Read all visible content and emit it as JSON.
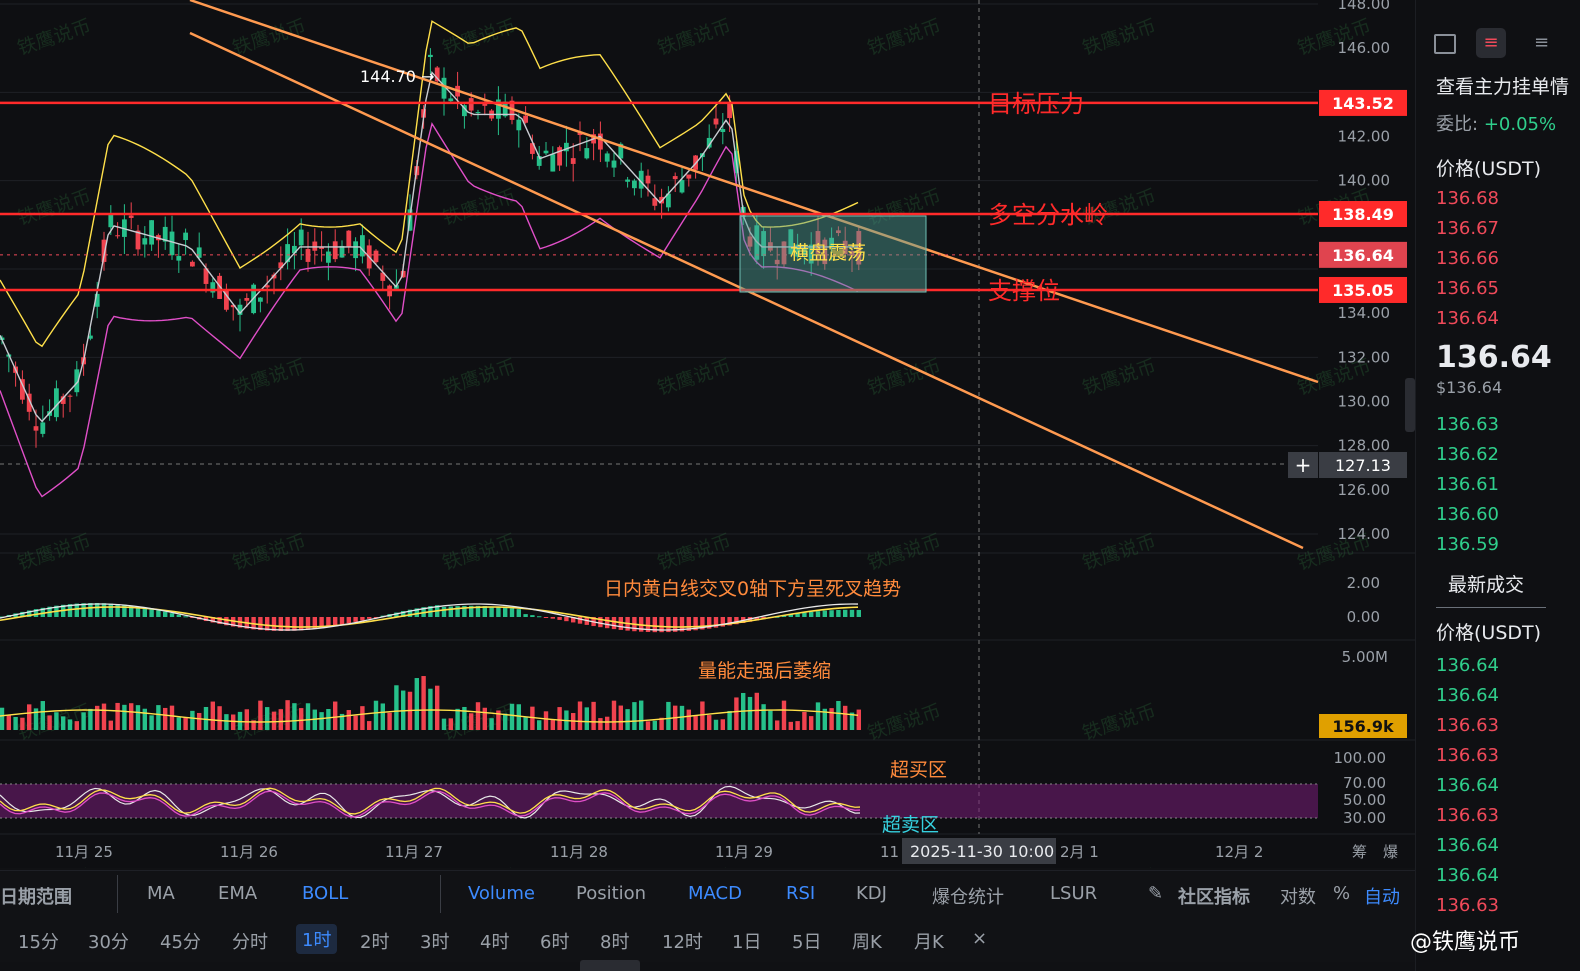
{
  "chart_data": {
    "type": "candlestick",
    "pair_unit": "USDT",
    "timeframe": "1时",
    "ylim": [
      122.5,
      148.5
    ],
    "y_ticks": [
      "148.00",
      "146.00",
      "142.00",
      "140.00",
      "134.00",
      "132.00",
      "130.00",
      "128.00",
      "126.00",
      "124.00"
    ],
    "x_ticks": [
      "11月 25",
      "11月 26",
      "11月 27",
      "11月 28",
      "11月 29",
      "11",
      "2025-11-30 10:00",
      "2月 1",
      "12月 2",
      "筹",
      "爆"
    ],
    "horizontal_levels": [
      {
        "value": 143.52,
        "label": "目标压力",
        "tag": "143.52"
      },
      {
        "value": 138.49,
        "label": "多空分水岭",
        "tag": "138.49"
      },
      {
        "value": 135.05,
        "label": "支撑位",
        "tag": "135.05"
      }
    ],
    "current_price": {
      "value": 136.64,
      "tag": "136.64"
    },
    "crosshair_price": "127.13",
    "high_marker": "144.70 →",
    "box_label": "横盘震荡",
    "indicators": {
      "macd": {
        "ticks": [
          "2.00",
          "0.00"
        ],
        "annotation": "日内黄白线交叉0轴下方呈死叉趋势"
      },
      "volume": {
        "ticks": [
          "5.00M"
        ],
        "annotation": "量能走强后萎缩",
        "current_tag": "156.9k"
      },
      "rsi": {
        "ticks": [
          "100.00",
          "70.00",
          "50.00",
          "30.00"
        ],
        "overbought_label": "超买区",
        "oversold_label": "超卖区"
      }
    },
    "watermark": "铁鹰说币"
  },
  "order_book": {
    "header": "查看主力挂单情",
    "ratio_label": "委比:",
    "ratio_value": "+0.05%",
    "price_header": "价格(USDT)",
    "asks": [
      "136.68",
      "136.67",
      "136.66",
      "136.65",
      "136.64"
    ],
    "last_price": "136.64",
    "last_price_usd": "$136.64",
    "bids": [
      "136.63",
      "136.62",
      "136.61",
      "136.60",
      "136.59"
    ],
    "latest_trades_title": "最新成交",
    "trades_header": "价格(USDT)",
    "trades": [
      {
        "price": "136.64",
        "side": "buy"
      },
      {
        "price": "136.64",
        "side": "buy"
      },
      {
        "price": "136.63",
        "side": "sell"
      },
      {
        "price": "136.63",
        "side": "sell"
      },
      {
        "price": "136.64",
        "side": "buy"
      },
      {
        "price": "136.63",
        "side": "sell"
      },
      {
        "price": "136.64",
        "side": "buy"
      },
      {
        "price": "136.64",
        "side": "buy"
      },
      {
        "price": "136.63",
        "side": "sell"
      }
    ]
  },
  "indicator_bar": {
    "date_range": "日期范围",
    "items": [
      "MA",
      "EMA",
      "BOLL",
      "Volume",
      "Position",
      "MACD",
      "RSI",
      "KDJ",
      "爆仓统计",
      "LSUR"
    ],
    "active": [
      "BOLL",
      "Volume",
      "MACD",
      "RSI"
    ],
    "community": "社区指标",
    "log": "对数",
    "percent": "%",
    "auto": "自动"
  },
  "time_bar": {
    "items": [
      "15分",
      "30分",
      "45分",
      "分时",
      "1时",
      "2时",
      "3时",
      "4时",
      "6时",
      "8时",
      "12时",
      "1日",
      "5日",
      "周K",
      "月K"
    ],
    "active": "1时",
    "close": "×"
  },
  "brand": "@铁鹰说币",
  "colors": {
    "up": "#26c08a",
    "down": "#f0434f",
    "level": "#ff2a2a",
    "channel": "#ff9a50",
    "boll_up": "#ffe04a",
    "boll_mid": "#c9ccd2",
    "boll_low": "#e04fc8"
  }
}
